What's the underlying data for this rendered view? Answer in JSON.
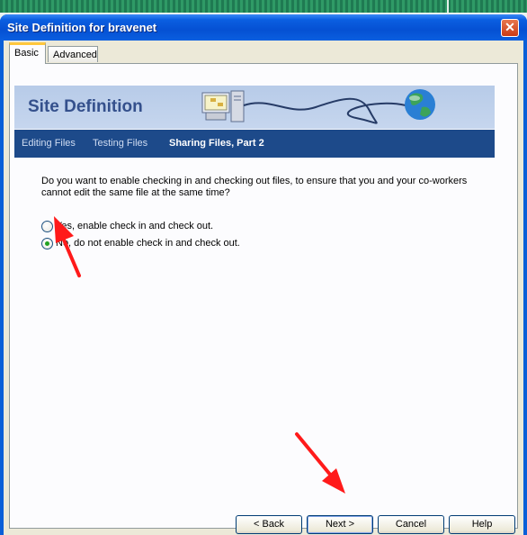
{
  "window": {
    "title": "Site Definition for bravenet",
    "close_glyph": "✕"
  },
  "tabs": [
    {
      "label": "Basic",
      "active": true
    },
    {
      "label": "Advanced",
      "active": false
    }
  ],
  "banner": {
    "title": "Site Definition",
    "art_icons": [
      "computer-icon",
      "globe-icon"
    ]
  },
  "wizard_steps": [
    {
      "label": "Editing Files",
      "current": false
    },
    {
      "label": "Testing Files",
      "current": false
    },
    {
      "label": "Sharing Files, Part 2",
      "current": true
    }
  ],
  "question": "Do you want to enable checking in and checking out files, to ensure that you and your co-workers cannot edit the same file at the same time?",
  "options": [
    {
      "label": "Yes, enable check in and check out.",
      "selected": false
    },
    {
      "label": "No, do not enable check in and check out.",
      "selected": true
    }
  ],
  "buttons": {
    "back": "< Back",
    "next": "Next >",
    "cancel": "Cancel",
    "help": "Help"
  },
  "colors": {
    "annotation_arrow": "#ff1a1a",
    "nav_bar": "#1d4a8a",
    "banner_title": "#34508c"
  }
}
